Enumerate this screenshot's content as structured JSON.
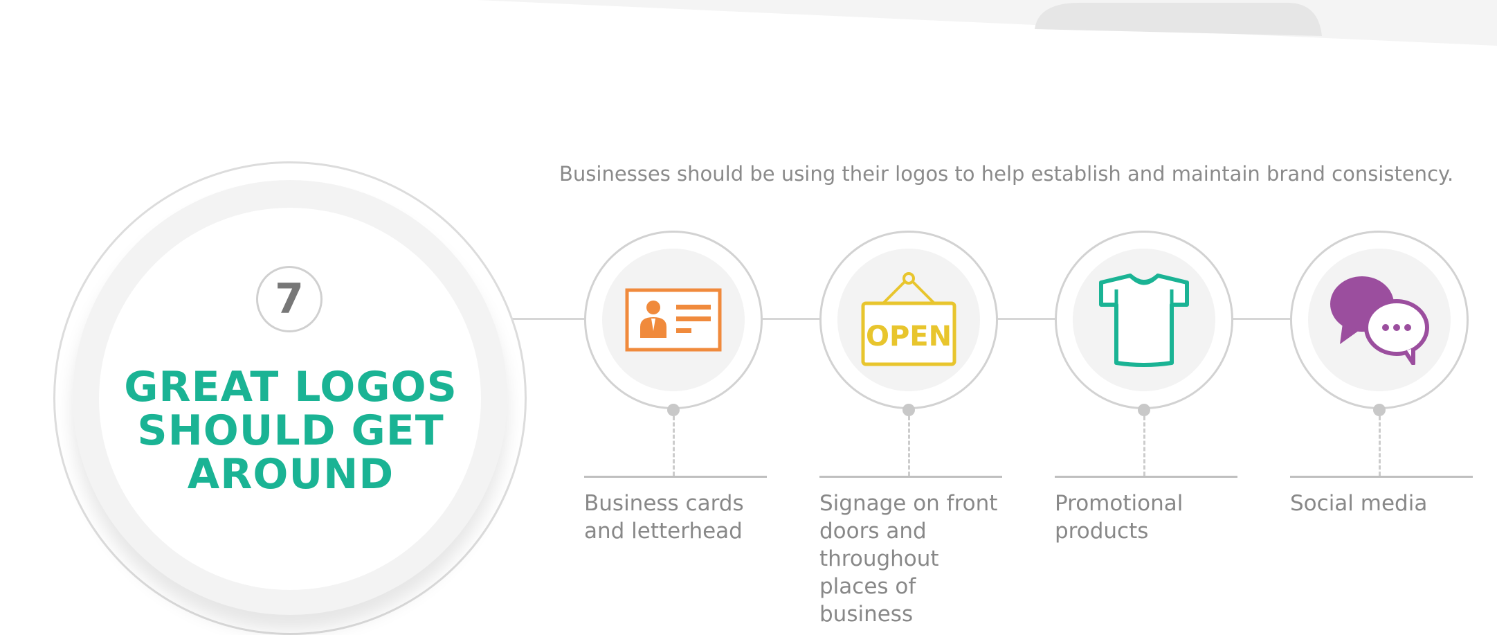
{
  "header": {
    "number": "7",
    "title_lines": [
      "GREAT LOGOS",
      "SHOULD GET",
      "AROUND"
    ]
  },
  "intro": "Businesses should be using their logos to help establish and maintain brand consistency.",
  "uses": [
    {
      "label": "Business cards and letterhead",
      "icon": "business-card-icon",
      "color": "#f08a3c"
    },
    {
      "label": "Signage on front doors and throughout places of business",
      "icon": "open-sign-icon",
      "color": "#e8c52d"
    },
    {
      "label": "Promotional products",
      "icon": "t-shirt-icon",
      "color": "#1ab394"
    },
    {
      "label": "Social media",
      "icon": "chat-bubbles-icon",
      "color": "#9b4e9e"
    }
  ],
  "open_sign_text": "OPEN",
  "colors": {
    "accent": "#1ab394",
    "text_gray": "#888888",
    "line_gray": "#d6d6d6"
  }
}
